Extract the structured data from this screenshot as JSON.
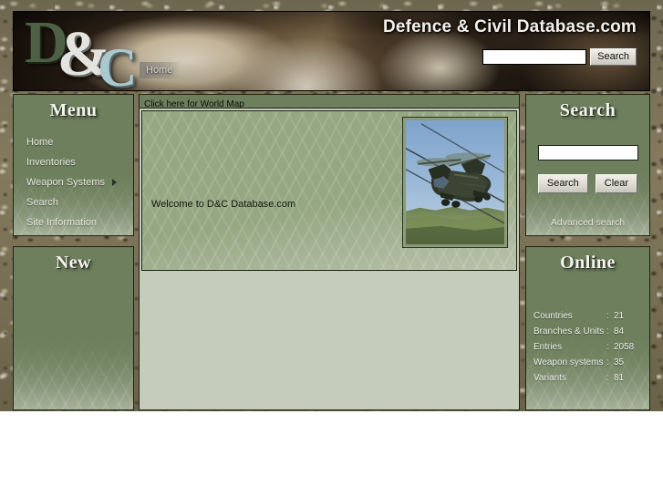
{
  "site": {
    "title": "Defence & Civil Database.com",
    "logo": {
      "part1": "D",
      "part2": "&",
      "part3": "C"
    }
  },
  "header": {
    "search": {
      "value": "",
      "placeholder": "",
      "button_label": "Search"
    },
    "nav": [
      {
        "label": "Home"
      }
    ]
  },
  "menu_panel": {
    "title": "Menu",
    "items": [
      {
        "label": "Home",
        "has_submenu": false
      },
      {
        "label": "Inventories",
        "has_submenu": false
      },
      {
        "label": "Weapon Systems",
        "has_submenu": true
      },
      {
        "label": "Search",
        "has_submenu": false
      },
      {
        "label": "Site Information",
        "has_submenu": false
      }
    ]
  },
  "new_panel": {
    "title": "New",
    "items": []
  },
  "content": {
    "world_map_link": "Click here for World Map",
    "welcome_text": "Welcome to D&C Database.com",
    "photo_alt": "Chinook helicopter in flight"
  },
  "search_panel": {
    "title": "Search",
    "input": {
      "value": "",
      "placeholder": ""
    },
    "search_label": "Search",
    "clear_label": "Clear",
    "advanced_label": "Advanced search"
  },
  "online_panel": {
    "title": "Online",
    "stats": [
      {
        "key": "Countries",
        "sep": ":",
        "value": "21"
      },
      {
        "key": "Branches & Units",
        "sep": ":",
        "value": "84"
      },
      {
        "key": "Entries",
        "sep": ":",
        "value": "2058"
      },
      {
        "key": "Weapon systems",
        "sep": ":",
        "value": "35"
      },
      {
        "key": "Variants",
        "sep": ":",
        "value": "81"
      }
    ]
  },
  "colors": {
    "panel_olive": "#6d7f5c",
    "content_green": "#96a883",
    "content_light": "#c6ccbb",
    "border_dark": "#1e2417",
    "title_text": "#f4f4f0"
  }
}
